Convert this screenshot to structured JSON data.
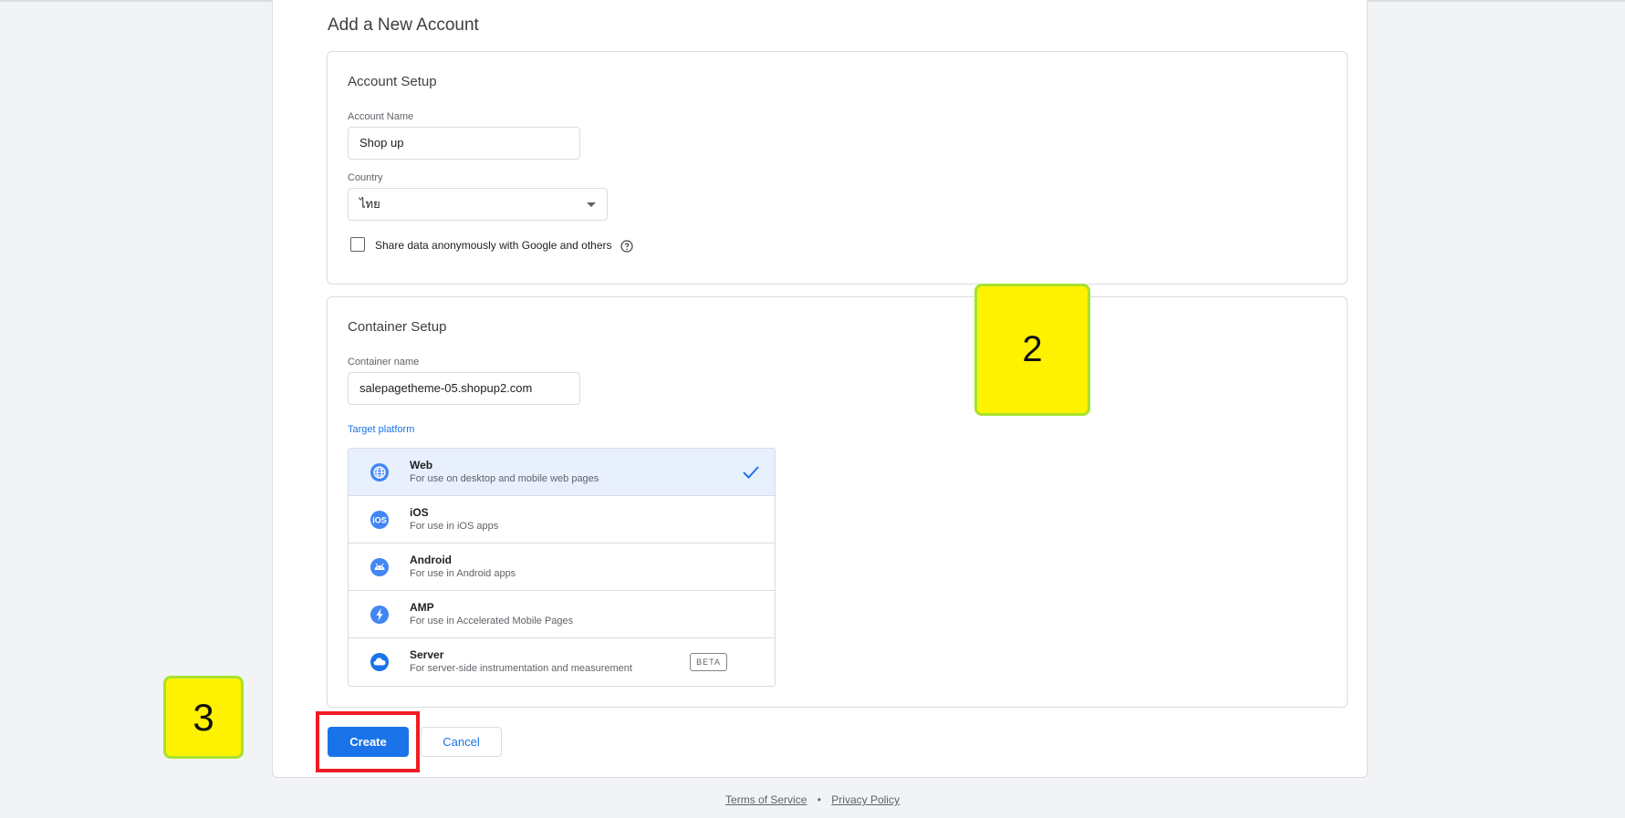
{
  "page": {
    "title": "Add a New Account"
  },
  "account_setup": {
    "title": "Account Setup",
    "account_name_label": "Account Name",
    "account_name_value": "Shop up",
    "country_label": "Country",
    "country_value": "ไทย",
    "share_data_label": "Share data anonymously with Google and others",
    "share_data_checked": false
  },
  "container_setup": {
    "title": "Container Setup",
    "container_name_label": "Container name",
    "container_name_value": "salepagetheme-05.shopup2.com",
    "target_platform_label": "Target platform",
    "platforms": [
      {
        "name": "Web",
        "description": "For use on desktop and mobile web pages",
        "icon": "globe-icon",
        "selected": true
      },
      {
        "name": "iOS",
        "description": "For use in iOS apps",
        "icon": "ios-icon",
        "selected": false
      },
      {
        "name": "Android",
        "description": "For use in Android apps",
        "icon": "android-icon",
        "selected": false
      },
      {
        "name": "AMP",
        "description": "For use in Accelerated Mobile Pages",
        "icon": "amp-bolt-icon",
        "selected": false
      },
      {
        "name": "Server",
        "description": "For server-side instrumentation and measurement",
        "icon": "cloud-icon",
        "selected": false,
        "badge": "BETA"
      }
    ]
  },
  "actions": {
    "create_label": "Create",
    "cancel_label": "Cancel"
  },
  "annotations": {
    "step_2": "2",
    "step_3": "3"
  },
  "footer": {
    "terms": "Terms of Service",
    "separator": "•",
    "privacy": "Privacy Policy"
  },
  "colors": {
    "accent": "#1a73e8",
    "selected_row": "#e8f0fe",
    "badge_yellow": "#fff200",
    "badge_border": "#a6e22e",
    "highlight_red": "#ee1c25"
  }
}
